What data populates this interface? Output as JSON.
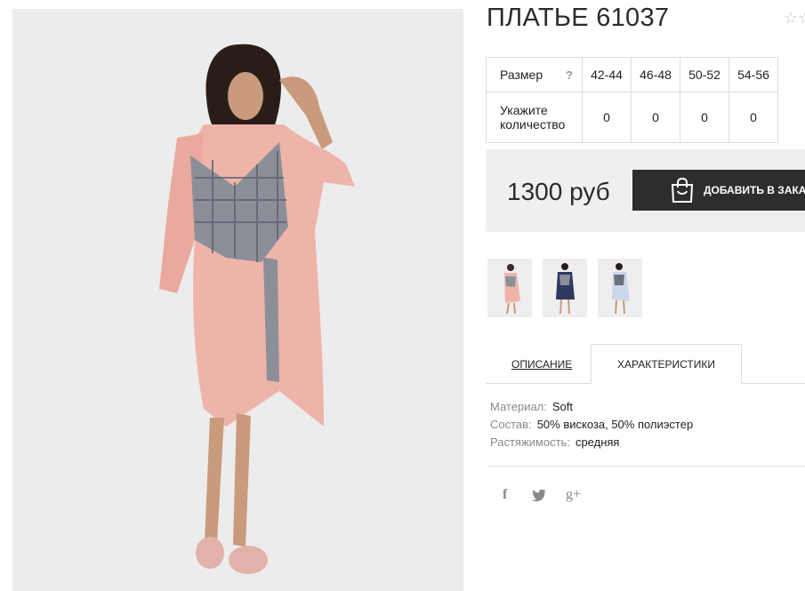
{
  "product": {
    "title": "ПЛАТЬЕ 61037",
    "rating_icon": "star-outline-icon"
  },
  "size_table": {
    "size_label": "Размер",
    "help_mark": "?",
    "qty_label_line1": "Укажите",
    "qty_label_line2": "количество",
    "sizes": [
      "42-44",
      "46-48",
      "50-52",
      "54-56"
    ],
    "quantities": [
      "0",
      "0",
      "0",
      "0"
    ]
  },
  "purchase": {
    "price": "1300 руб",
    "add_to_cart": "ДОБАВИТЬ В ЗАКАЗ",
    "cart_icon": "shopping-bag-icon"
  },
  "thumbnails": [
    {
      "name": "thumb-pink-dress"
    },
    {
      "name": "thumb-navy-dress"
    },
    {
      "name": "thumb-blue-dress"
    }
  ],
  "tabs": {
    "description": "ОПИСАНИЕ",
    "characteristics": "ХАРАКТЕРИСТИКИ",
    "active": "characteristics"
  },
  "specs": [
    {
      "key": "Материал:",
      "value": "Soft"
    },
    {
      "key": "Состав:",
      "value": "50% вискоза, 50% полиэстер"
    },
    {
      "key": "Растяжимость:",
      "value": "средняя"
    }
  ],
  "social": {
    "facebook": "f",
    "twitter": "twitter-icon",
    "google_plus": "g+"
  },
  "colors": {
    "button_bg": "#2d2d2d",
    "panel_bg": "#efefef",
    "border": "#dcdcdc",
    "dress_pink": "#eeb4aa",
    "plaid_grey": "#8d8f98"
  }
}
